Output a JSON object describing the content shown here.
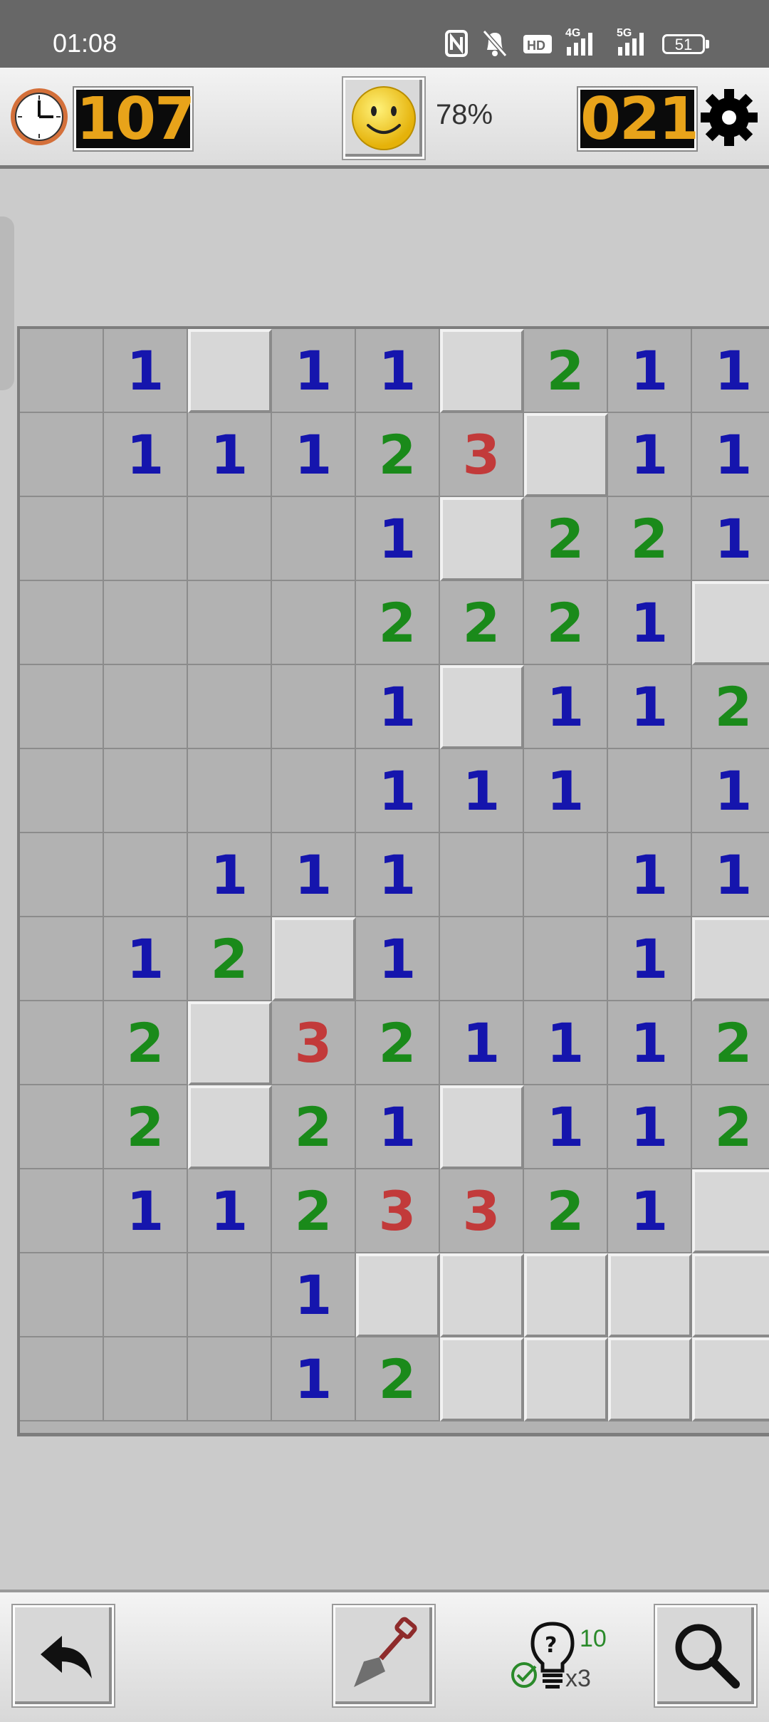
{
  "status_bar": {
    "time": "01:08",
    "network_1": "4G",
    "network_2": "5G",
    "battery": "51"
  },
  "header": {
    "timer": "107",
    "progress": "78%",
    "mines_left": "021"
  },
  "board": {
    "cols": 9,
    "rows": [
      [
        "",
        "1",
        "#",
        "1",
        "1",
        "#",
        "2",
        "1",
        "1"
      ],
      [
        "",
        "1",
        "1",
        "1",
        "2",
        "3",
        "#",
        "1",
        "1"
      ],
      [
        "",
        "",
        "",
        "",
        "1",
        "#",
        "2",
        "2",
        "1"
      ],
      [
        "",
        "",
        "",
        "",
        "2",
        "2",
        "2",
        "1",
        "#"
      ],
      [
        "",
        "",
        "",
        "",
        "1",
        "#",
        "1",
        "1",
        "2"
      ],
      [
        "",
        "",
        "",
        "",
        "1",
        "1",
        "1",
        "",
        "1"
      ],
      [
        "",
        "",
        "1",
        "1",
        "1",
        "",
        "",
        "1",
        "1"
      ],
      [
        "",
        "1",
        "2",
        "#",
        "1",
        "",
        "",
        "1",
        "#"
      ],
      [
        "",
        "2",
        "#",
        "3",
        "2",
        "1",
        "1",
        "1",
        "2"
      ],
      [
        "",
        "2",
        "#",
        "2",
        "1",
        "#",
        "1",
        "1",
        "2"
      ],
      [
        "",
        "1",
        "1",
        "2",
        "3",
        "3",
        "2",
        "1",
        "#"
      ],
      [
        "",
        "",
        "",
        "1",
        "#",
        "#",
        "#",
        "#",
        "#"
      ],
      [
        "",
        "",
        "",
        "1",
        "2",
        "#",
        "#",
        "#",
        "#"
      ]
    ]
  },
  "toolbar": {
    "hint_count": "10",
    "hint_multiplier": "x3"
  },
  "colors": {
    "one": "#1515ad",
    "two": "#1a8a1a",
    "three": "#c23a3a",
    "lcd_digits": "#e8a31a"
  },
  "icons": {
    "clock": "clock-icon",
    "smiley": "smiley-face-icon",
    "settings": "gear-icon",
    "undo": "undo-arrow-icon",
    "shovel": "shovel-icon",
    "hint": "lightbulb-icon",
    "zoom": "magnifier-icon"
  }
}
